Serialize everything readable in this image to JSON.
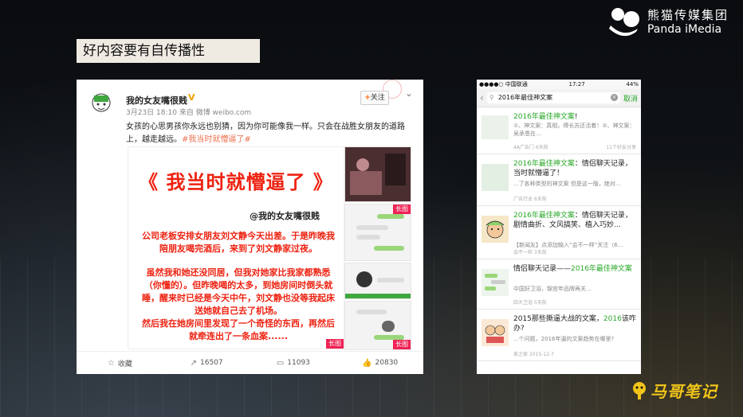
{
  "brand": {
    "name_cn": "熊猫传媒集团",
    "name_en": "Panda iMedia"
  },
  "slide": {
    "title": "好内容要有自传播性"
  },
  "weibo": {
    "user_name": "我的女友嘴很贱",
    "verified_mark": "V",
    "meta": "3月23日 18:10 来自 微博 weibo.com",
    "follow_label": "关注",
    "body_text": "女孩的心思男孩你永远也别猜，因为你可能像我一样。只会在战胜女朋友的道路上，越走越远。",
    "hashtag": "#我当时就懵逼了#",
    "image": {
      "headline": "《 我当时就懵逼了 》",
      "handle": "@我的女友嘴很贱",
      "paragraphs": [
        "公司老板安排女朋友刘文静今天出差。于是昨晚我陪朋友喝完酒后，来到了刘文静家过夜。",
        "虽然我和她还没同居，但我对她家比我家都熟悉（你懂的）。但昨晚喝的太多，到她房间时倒头就睡，醒来时已经是今天中午，刘文静也没等我起床送她就自己去了机场。",
        "然后我在她房间里发现了一个奇怪的东西，再然后就牵连出了一条血案......"
      ],
      "long_badge": "长图"
    },
    "actions": [
      {
        "icon": "star-icon",
        "label": "收藏"
      },
      {
        "icon": "share-icon",
        "label": "16507"
      },
      {
        "icon": "comment-icon",
        "label": "11093"
      },
      {
        "icon": "like-icon",
        "label": "20830"
      }
    ]
  },
  "phone": {
    "status": {
      "carrier": "●●●●○ 中国联通 ",
      "time": "17:27",
      "battery": "44%"
    },
    "search_query": "2016年最佳神文案",
    "cancel_label": "取消",
    "results": [
      {
        "title_pre": "",
        "title_hl": "2016年最佳神文案",
        "title_post": "!",
        "desc": "①、神文案：真相，傅长苏还活着！②、神文案：吴承恩在...",
        "source": "4A广告门 6天前",
        "reads": "11个好友分享"
      },
      {
        "title_pre": "",
        "title_hl": "2016年最佳神文案",
        "title_post": "：情侣聊天记录，当时就懵逼了！",
        "desc": "...了各种类型的神文案 但是这一版，绝对...",
        "source": "广告行业 6天前",
        "reads": ""
      },
      {
        "title_pre": "",
        "title_hl": "2016年最佳神文案",
        "title_post": "：情侣聊天记录，剧情曲折、文风搞笑、植入巧妙...",
        "desc": "【新闻友】点添加输入“会不一样”关注（6...",
        "source": "会不一样 3天前",
        "reads": ""
      },
      {
        "title_pre": "情侣聊天记录——",
        "title_hl": "2016年最佳神文案",
        "title_post": "",
        "desc": "中国好卫浴，锦宫年品牌再关...",
        "source": "四大卫浴 5天前",
        "reads": ""
      },
      {
        "title_pre": "2015那些撕逼大战的文案，",
        "title_hl": "2016",
        "title_post": "该咋办?",
        "desc": "...个问题，2016年逼的文案趋势在哪里?",
        "source": "泉之家 2015-12-7",
        "reads": ""
      }
    ]
  },
  "footer": {
    "logo_text": "马哥笔记"
  }
}
